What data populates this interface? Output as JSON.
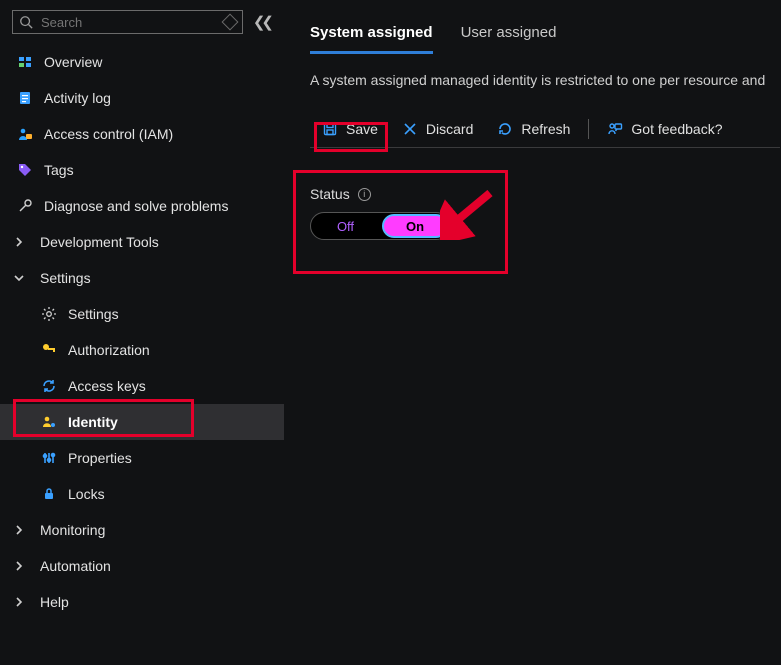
{
  "search": {
    "placeholder": "Search"
  },
  "sidebar": {
    "overview": "Overview",
    "activity_log": "Activity log",
    "access_control": "Access control (IAM)",
    "tags": "Tags",
    "diagnose": "Diagnose and solve problems",
    "development_tools": "Development Tools",
    "settings_group": "Settings",
    "settings_item": "Settings",
    "authorization": "Authorization",
    "access_keys": "Access keys",
    "identity": "Identity",
    "properties": "Properties",
    "locks": "Locks",
    "monitoring": "Monitoring",
    "automation": "Automation",
    "help": "Help"
  },
  "tabs": {
    "system": "System assigned",
    "user": "User assigned"
  },
  "description": "A system assigned managed identity is restricted to one per resource and",
  "toolbar": {
    "save": "Save",
    "discard": "Discard",
    "refresh": "Refresh",
    "feedback": "Got feedback?"
  },
  "status": {
    "label": "Status",
    "off": "Off",
    "on": "On"
  }
}
